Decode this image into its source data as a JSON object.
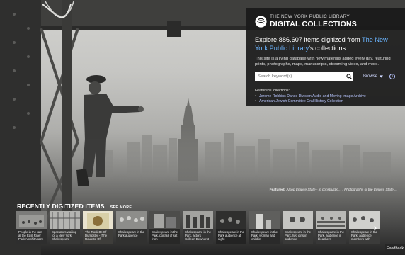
{
  "panel": {
    "brand_small": "THE NEW YORK PUBLIC LIBRARY",
    "brand_big": "DIGITAL COLLECTIONS",
    "explore_prefix": "Explore 886,607 items digitized from ",
    "explore_link": "The New York Public Library",
    "explore_suffix": "'s collections.",
    "description": "This site is a living database with new materials added every day, featuring prints, photographs, maps, manuscripts, streaming video, and more.",
    "search_placeholder": "Search keyword(s)",
    "browse_label": "Browse",
    "info_label": "i",
    "featured_heading": "Featured Collections:",
    "featured_items": [
      "Jerome Robbins Dance Division Audio and Moving Image Archive",
      "American Jewish Committee Oral History Collection"
    ]
  },
  "caption": {
    "label": "Featured:",
    "text": "Alsop Empire State - in constructio... ; Photographs of the Empire State ..."
  },
  "recent": {
    "title": "RECENTLY DIGITIZED ITEMS",
    "see_more": "SEE MORE",
    "items": [
      "People in the rain at the East River Park Amphitheatre",
      "Spectators waiting for a New York Shakespeare",
      "The Roulette Of Dumpster - [The Roulette Of",
      "Shakespeare in the Park audience",
      "Shakespeare in the Park, portrait of set from",
      "Shakespeare in the Park, actors Colleen Dewhurst",
      "Shakespeare in the Park audience at night",
      "Shakespeare in the Park, woman and child in",
      "Shakespeare in the Park, two girls in audience",
      "Shakespeare in the Park, audience in bleachers",
      "Shakespeare in the Park, audience members with"
    ],
    "next_label": "›"
  },
  "feedback_label": "Feedback"
}
